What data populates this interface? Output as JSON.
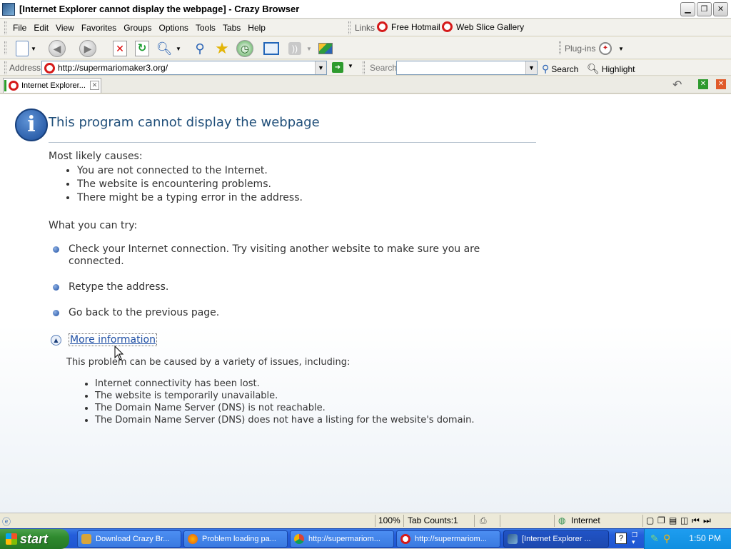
{
  "window": {
    "title": "[Internet Explorer cannot display the webpage] - Crazy Browser"
  },
  "menu": {
    "items": [
      "File",
      "Edit",
      "View",
      "Favorites",
      "Groups",
      "Options",
      "Tools",
      "Tabs",
      "Help"
    ]
  },
  "links": {
    "label": "Links",
    "items": [
      "Free Hotmail",
      "Web Slice Gallery"
    ]
  },
  "toolbar": {
    "plugins_label": "Plug-ins"
  },
  "address": {
    "label": "Address",
    "url": "http://supermariomaker3.org/"
  },
  "search": {
    "label": "Search",
    "button": "Search",
    "highlight": "Highlight"
  },
  "tab": {
    "label": "Internet Explorer..."
  },
  "page": {
    "heading": "This program cannot display the webpage",
    "causes_title": "Most likely causes:",
    "causes": [
      "You are not connected to the Internet.",
      "The website is encountering problems.",
      "There might be a typing error in the address."
    ],
    "try_title": "What you can try:",
    "try_items": [
      "Check your Internet connection. Try visiting another website to make sure you are connected.",
      "Retype the address.",
      "Go back to the previous page."
    ],
    "more_info": "More information",
    "detail_intro": "This problem can be caused by a variety of issues, including:",
    "details": [
      "Internet connectivity has been lost.",
      "The website is temporarily unavailable.",
      "The Domain Name Server (DNS) is not reachable.",
      "The Domain Name Server (DNS) does not have a listing for the website's domain."
    ]
  },
  "status": {
    "zoom": "100%",
    "tab_counts": "Tab Counts:1",
    "zone": "Internet"
  },
  "taskbar": {
    "start": "start",
    "tasks": [
      "Download Crazy Br...",
      "Problem loading pa...",
      "http://supermariom...",
      "http://supermariom...",
      "[Internet Explorer ..."
    ],
    "clock": "1:50 PM"
  }
}
